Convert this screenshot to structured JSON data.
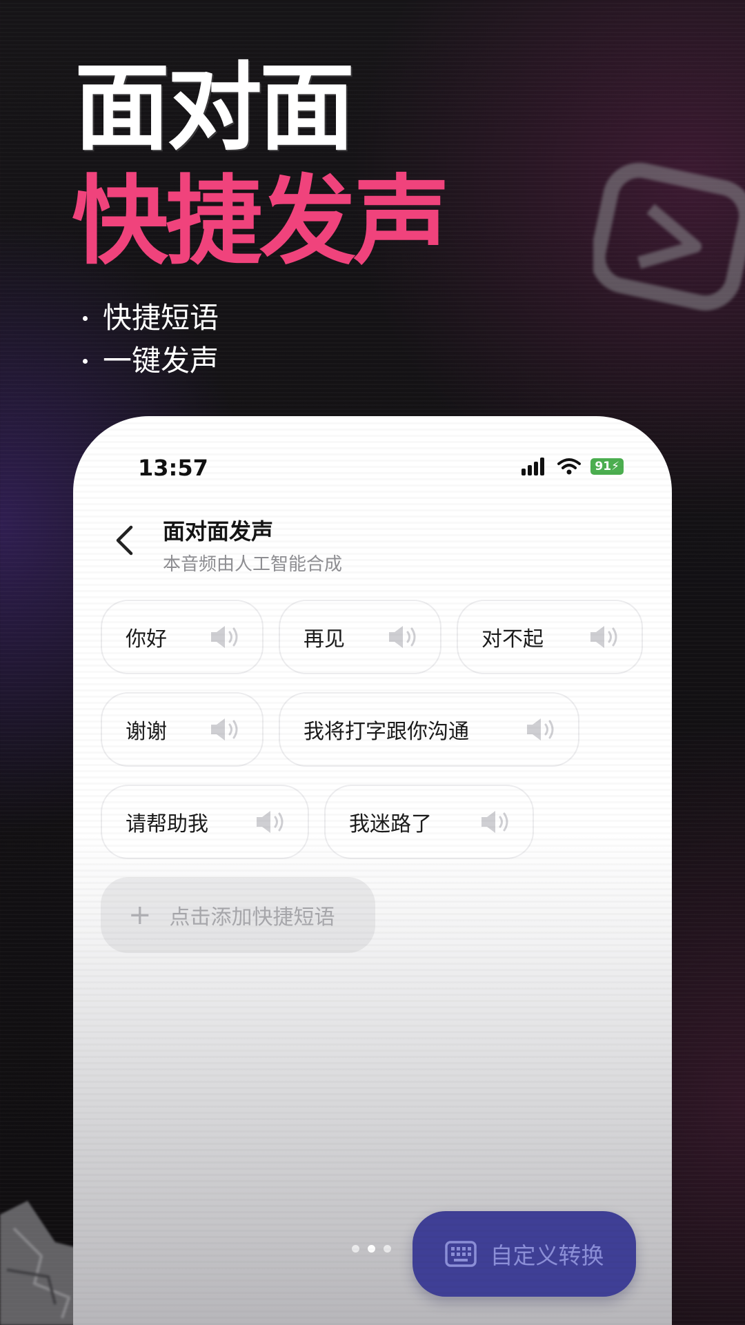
{
  "promo": {
    "headline_line1": "面对面",
    "headline_line2": "快捷发声",
    "bullets": [
      "快捷短语",
      "一键发声"
    ]
  },
  "status_bar": {
    "time": "13:57",
    "battery": "91"
  },
  "header": {
    "title": "面对面发声",
    "subtitle": "本音频由人工智能合成"
  },
  "phrases": [
    {
      "label": "你好"
    },
    {
      "label": "再见"
    },
    {
      "label": "对不起"
    },
    {
      "label": "谢谢"
    },
    {
      "label": "我将打字跟你沟通"
    },
    {
      "label": "请帮助我"
    },
    {
      "label": "我迷路了"
    }
  ],
  "add_phrase": {
    "label": "点击添加快捷短语"
  },
  "bottom": {
    "convert_label": "自定义转换",
    "page_indicator": {
      "count": 3,
      "active_index": 1
    }
  },
  "colors": {
    "accent_pink": "#f0437c",
    "button_blue": "#3f3f96",
    "battery_green": "#4caf50"
  },
  "icons": [
    "play-icon",
    "signal-icon",
    "wifi-icon",
    "battery-icon",
    "back-arrow-icon",
    "speaker-icon",
    "plus-icon",
    "keyboard-icon"
  ]
}
